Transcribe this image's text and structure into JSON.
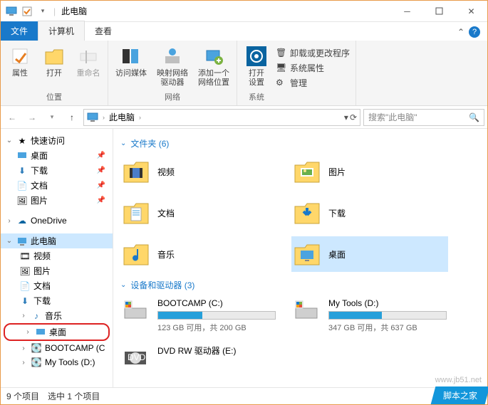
{
  "window": {
    "title": "此电脑"
  },
  "tabs": {
    "file": "文件",
    "computer": "计算机",
    "view": "查看"
  },
  "ribbon": {
    "location": {
      "group": "位置",
      "properties": "属性",
      "open": "打开",
      "rename": "重命名"
    },
    "network": {
      "group": "网络",
      "media": "访问媒体",
      "map": "映射网络\n驱动器",
      "addloc": "添加一个\n网络位置"
    },
    "system": {
      "group": "系统",
      "settings": "打开\n设置",
      "uninstall": "卸载或更改程序",
      "sysprops": "系统属性",
      "manage": "管理"
    }
  },
  "nav": {
    "crumb": "此电脑",
    "search_placeholder": "搜索\"此电脑\""
  },
  "tree": {
    "quick": "快速访问",
    "desktop": "桌面",
    "downloads": "下载",
    "documents": "文档",
    "pictures": "图片",
    "onedrive": "OneDrive",
    "thispc": "此电脑",
    "videos": "视频",
    "music": "音乐",
    "bootcamp": "BOOTCAMP (C",
    "mytools": "My Tools (D:)"
  },
  "content": {
    "folders_header": "文件夹 (6)",
    "folders": [
      {
        "label": "视频",
        "icon": "video"
      },
      {
        "label": "图片",
        "icon": "pictures"
      },
      {
        "label": "文档",
        "icon": "documents"
      },
      {
        "label": "下载",
        "icon": "downloads"
      },
      {
        "label": "音乐",
        "icon": "music"
      },
      {
        "label": "桌面",
        "icon": "desktop",
        "selected": true
      }
    ],
    "drives_header": "设备和驱动器 (3)",
    "drives": [
      {
        "name": "BOOTCAMP (C:)",
        "free_text": "123 GB 可用，共 200 GB",
        "pct": 38
      },
      {
        "name": "My Tools (D:)",
        "free_text": "347 GB 可用，共 637 GB",
        "pct": 45
      },
      {
        "name": "DVD RW 驱动器 (E:)",
        "type": "dvd"
      }
    ]
  },
  "status": {
    "items": "9 个项目",
    "selected": "选中 1 个项目"
  },
  "watermark": "www.jb51.net",
  "badge": "脚本之家"
}
